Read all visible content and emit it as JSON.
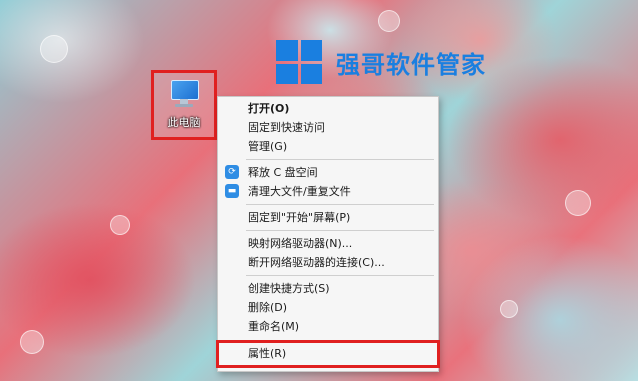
{
  "desktop": {
    "icon_label": "此电脑"
  },
  "watermark": {
    "text": "强哥软件管家"
  },
  "context_menu": {
    "items": [
      {
        "label": "打开(O)"
      },
      {
        "label": "固定到快速访问"
      },
      {
        "label": "管理(G)"
      },
      {
        "label": "释放 C 盘空间"
      },
      {
        "label": "清理大文件/重复文件"
      },
      {
        "label": "固定到\"开始\"屏幕(P)"
      },
      {
        "label": "映射网络驱动器(N)..."
      },
      {
        "label": "断开网络驱动器的连接(C)..."
      },
      {
        "label": "创建快捷方式(S)"
      },
      {
        "label": "删除(D)"
      },
      {
        "label": "重命名(M)"
      },
      {
        "label": "属性(R)"
      }
    ]
  },
  "colors": {
    "highlight_border": "#e02020",
    "watermark_blue": "#1a7fe0"
  }
}
